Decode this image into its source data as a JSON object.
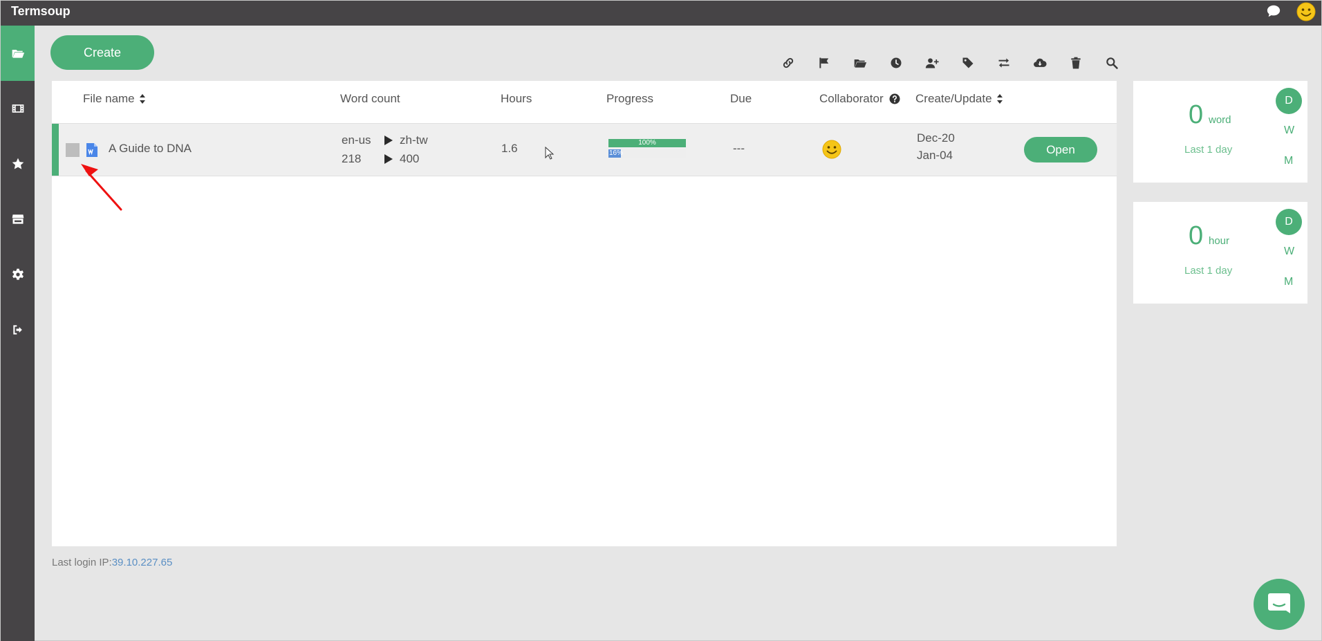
{
  "app": {
    "title": "Termsoup"
  },
  "actions": {
    "create_label": "Create"
  },
  "table": {
    "headers": {
      "file_name": "File name",
      "word_count": "Word count",
      "hours": "Hours",
      "progress": "Progress",
      "due": "Due",
      "collaborator": "Collaborator",
      "create_update": "Create/Update"
    },
    "rows": [
      {
        "file_name": "A Guide to DNA",
        "source_lang": "en-us",
        "target_lang": "zh-tw",
        "source_count": "218",
        "target_count": "400",
        "hours": "1.6",
        "progress_1": 1.0,
        "progress_1_label": "100%",
        "progress_2": 0.16,
        "progress_2_label": "16%",
        "due": "---",
        "created": "Dec-20",
        "updated": "Jan-04",
        "open_label": "Open"
      }
    ]
  },
  "footer": {
    "last_login_label": "Last login IP:",
    "ip": "39.10.227.65"
  },
  "stats": [
    {
      "value": "0",
      "unit": "word",
      "period": "Last 1 day",
      "options": [
        "D",
        "W",
        "M"
      ]
    },
    {
      "value": "0",
      "unit": "hour",
      "period": "Last 1 day",
      "options": [
        "D",
        "W",
        "M"
      ]
    }
  ],
  "colors": {
    "accent": "#4caf78",
    "sidebar": "#464446",
    "link": "#5a8fc4",
    "progress_2": "#5b8fd8"
  },
  "icons": {
    "sidebar": [
      "folder-open-icon",
      "film-icon",
      "star-icon",
      "store-icon",
      "gear-icon",
      "sign-out-icon"
    ],
    "toolbar": [
      "link-icon",
      "flag-icon",
      "folder-open-icon",
      "clock-icon",
      "user-plus-icon",
      "tag-icon",
      "exchange-icon",
      "cloud-download-icon",
      "trash-icon",
      "search-icon"
    ]
  }
}
